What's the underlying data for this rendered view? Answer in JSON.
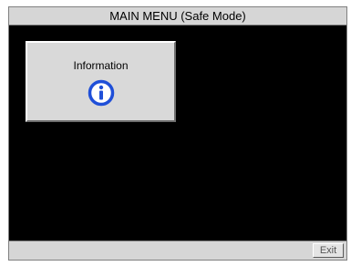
{
  "window": {
    "title": "MAIN MENU (Safe Mode)"
  },
  "menu": {
    "items": [
      {
        "label": "Information",
        "icon": "info-icon"
      }
    ]
  },
  "status_bar": {
    "exit_label": "Exit"
  },
  "colors": {
    "background": "#000000",
    "panel": "#d6d6d6",
    "tile": "#d9d9d9",
    "info_icon_blue": "#1f4fd8"
  }
}
